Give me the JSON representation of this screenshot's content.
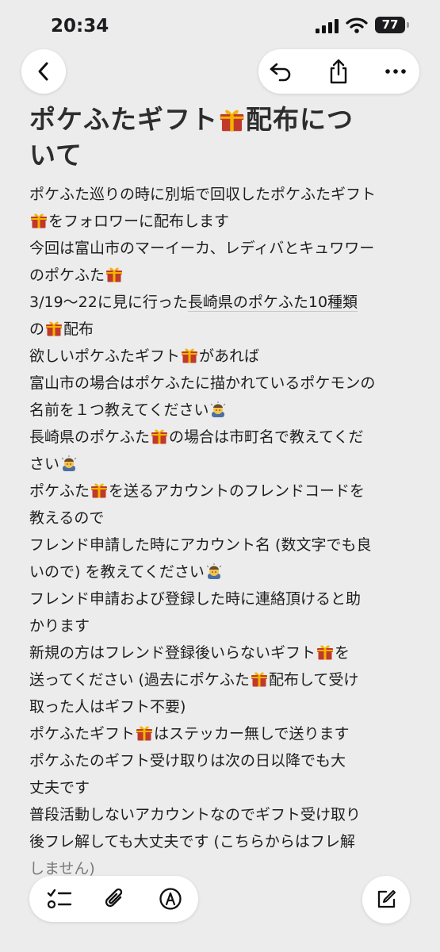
{
  "status_bar": {
    "time": "20:34",
    "battery": "77"
  },
  "note": {
    "title_line1": "ポケふたギフト",
    "title_line2": "配布につ",
    "title_line3": "いて",
    "body": {
      "l1": "ポケふた巡りの時に別垢で回収したポケふたギフト",
      "l2": "をフォロワーに配布します",
      "l3": "今回は富山市のマーイーカ、レディバとキュワワー",
      "l4": "のポケふた",
      "l5a": "3/19～22",
      "l5b": "に見に行った",
      "l5c": "長崎県のポケふた10種類",
      "l6a": "の",
      "l6b": "配布",
      "l7a": "欲しいポケふたギフト",
      "l7b": "があれば",
      "l8": "富山市の場合はポケふたに描かれているポケモンの",
      "l9": "名前を１つ教えてください",
      "l10a": "長崎県のポケふた",
      "l10b": "の場合は市町名で教えてくだ",
      "l11": "さい",
      "l12a": "ポケふた",
      "l12b": "を送るアカウントのフレンドコードを",
      "l13": "教えるので",
      "l14": "フレンド申請した時にアカウント名 (数文字でも良",
      "l15": "いので) を教えてください",
      "l16": "フレンド申請および登録した時に連絡頂けると助",
      "l17": "かります",
      "l18a": "新規の方はフレンド登録後いらないギフト",
      "l18b": "を",
      "l19a": "送ってください (過去にポケふた",
      "l19b": "配布して受け",
      "l20": "取った人はギフト不要)",
      "l21a": "ポケふたギフト",
      "l21b": "はステッカー無しで送ります",
      "l22": "ポケふたのギフト受け取りは次の日以降でも大",
      "l23": "丈夫です",
      "l24": "普段活動しないアカウントなのでギフト受け取り",
      "l25": "後フレ解しても大丈夫です (こちらからはフレ解",
      "l26": "しません)"
    }
  },
  "icons": {
    "back": "chevron-left-icon",
    "undo": "undo-arrow-icon",
    "share": "share-icon",
    "more": "ellipsis-icon",
    "gift": "wrapped-gift-emoji",
    "bow": "person-bowing-emoji",
    "checklist": "checklist-icon",
    "attach": "paperclip-icon",
    "markup": "markup-pen-icon",
    "compose": "compose-icon"
  },
  "colors": {
    "background": "#ececec",
    "gift_red": "#c0392b",
    "gift_gold": "#f4b400"
  }
}
